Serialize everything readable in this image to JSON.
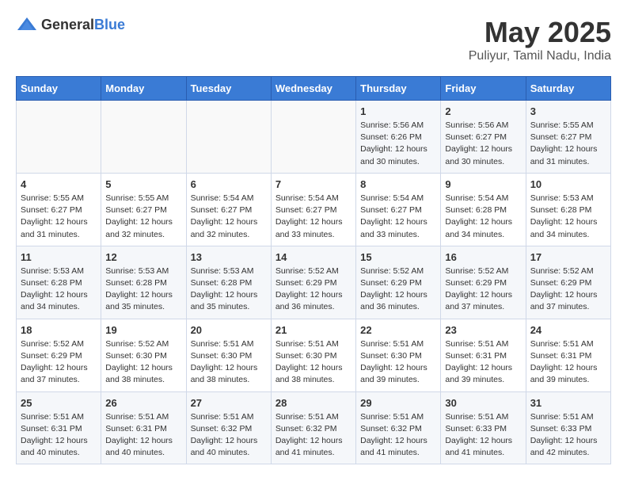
{
  "header": {
    "logo_general": "General",
    "logo_blue": "Blue",
    "month_title": "May 2025",
    "location": "Puliyur, Tamil Nadu, India"
  },
  "days_of_week": [
    "Sunday",
    "Monday",
    "Tuesday",
    "Wednesday",
    "Thursday",
    "Friday",
    "Saturday"
  ],
  "weeks": [
    [
      {
        "day": "",
        "info": ""
      },
      {
        "day": "",
        "info": ""
      },
      {
        "day": "",
        "info": ""
      },
      {
        "day": "",
        "info": ""
      },
      {
        "day": "1",
        "info": "Sunrise: 5:56 AM\nSunset: 6:26 PM\nDaylight: 12 hours\nand 30 minutes."
      },
      {
        "day": "2",
        "info": "Sunrise: 5:56 AM\nSunset: 6:27 PM\nDaylight: 12 hours\nand 30 minutes."
      },
      {
        "day": "3",
        "info": "Sunrise: 5:55 AM\nSunset: 6:27 PM\nDaylight: 12 hours\nand 31 minutes."
      }
    ],
    [
      {
        "day": "4",
        "info": "Sunrise: 5:55 AM\nSunset: 6:27 PM\nDaylight: 12 hours\nand 31 minutes."
      },
      {
        "day": "5",
        "info": "Sunrise: 5:55 AM\nSunset: 6:27 PM\nDaylight: 12 hours\nand 32 minutes."
      },
      {
        "day": "6",
        "info": "Sunrise: 5:54 AM\nSunset: 6:27 PM\nDaylight: 12 hours\nand 32 minutes."
      },
      {
        "day": "7",
        "info": "Sunrise: 5:54 AM\nSunset: 6:27 PM\nDaylight: 12 hours\nand 33 minutes."
      },
      {
        "day": "8",
        "info": "Sunrise: 5:54 AM\nSunset: 6:27 PM\nDaylight: 12 hours\nand 33 minutes."
      },
      {
        "day": "9",
        "info": "Sunrise: 5:54 AM\nSunset: 6:28 PM\nDaylight: 12 hours\nand 34 minutes."
      },
      {
        "day": "10",
        "info": "Sunrise: 5:53 AM\nSunset: 6:28 PM\nDaylight: 12 hours\nand 34 minutes."
      }
    ],
    [
      {
        "day": "11",
        "info": "Sunrise: 5:53 AM\nSunset: 6:28 PM\nDaylight: 12 hours\nand 34 minutes."
      },
      {
        "day": "12",
        "info": "Sunrise: 5:53 AM\nSunset: 6:28 PM\nDaylight: 12 hours\nand 35 minutes."
      },
      {
        "day": "13",
        "info": "Sunrise: 5:53 AM\nSunset: 6:28 PM\nDaylight: 12 hours\nand 35 minutes."
      },
      {
        "day": "14",
        "info": "Sunrise: 5:52 AM\nSunset: 6:29 PM\nDaylight: 12 hours\nand 36 minutes."
      },
      {
        "day": "15",
        "info": "Sunrise: 5:52 AM\nSunset: 6:29 PM\nDaylight: 12 hours\nand 36 minutes."
      },
      {
        "day": "16",
        "info": "Sunrise: 5:52 AM\nSunset: 6:29 PM\nDaylight: 12 hours\nand 37 minutes."
      },
      {
        "day": "17",
        "info": "Sunrise: 5:52 AM\nSunset: 6:29 PM\nDaylight: 12 hours\nand 37 minutes."
      }
    ],
    [
      {
        "day": "18",
        "info": "Sunrise: 5:52 AM\nSunset: 6:29 PM\nDaylight: 12 hours\nand 37 minutes."
      },
      {
        "day": "19",
        "info": "Sunrise: 5:52 AM\nSunset: 6:30 PM\nDaylight: 12 hours\nand 38 minutes."
      },
      {
        "day": "20",
        "info": "Sunrise: 5:51 AM\nSunset: 6:30 PM\nDaylight: 12 hours\nand 38 minutes."
      },
      {
        "day": "21",
        "info": "Sunrise: 5:51 AM\nSunset: 6:30 PM\nDaylight: 12 hours\nand 38 minutes."
      },
      {
        "day": "22",
        "info": "Sunrise: 5:51 AM\nSunset: 6:30 PM\nDaylight: 12 hours\nand 39 minutes."
      },
      {
        "day": "23",
        "info": "Sunrise: 5:51 AM\nSunset: 6:31 PM\nDaylight: 12 hours\nand 39 minutes."
      },
      {
        "day": "24",
        "info": "Sunrise: 5:51 AM\nSunset: 6:31 PM\nDaylight: 12 hours\nand 39 minutes."
      }
    ],
    [
      {
        "day": "25",
        "info": "Sunrise: 5:51 AM\nSunset: 6:31 PM\nDaylight: 12 hours\nand 40 minutes."
      },
      {
        "day": "26",
        "info": "Sunrise: 5:51 AM\nSunset: 6:31 PM\nDaylight: 12 hours\nand 40 minutes."
      },
      {
        "day": "27",
        "info": "Sunrise: 5:51 AM\nSunset: 6:32 PM\nDaylight: 12 hours\nand 40 minutes."
      },
      {
        "day": "28",
        "info": "Sunrise: 5:51 AM\nSunset: 6:32 PM\nDaylight: 12 hours\nand 41 minutes."
      },
      {
        "day": "29",
        "info": "Sunrise: 5:51 AM\nSunset: 6:32 PM\nDaylight: 12 hours\nand 41 minutes."
      },
      {
        "day": "30",
        "info": "Sunrise: 5:51 AM\nSunset: 6:33 PM\nDaylight: 12 hours\nand 41 minutes."
      },
      {
        "day": "31",
        "info": "Sunrise: 5:51 AM\nSunset: 6:33 PM\nDaylight: 12 hours\nand 42 minutes."
      }
    ]
  ]
}
